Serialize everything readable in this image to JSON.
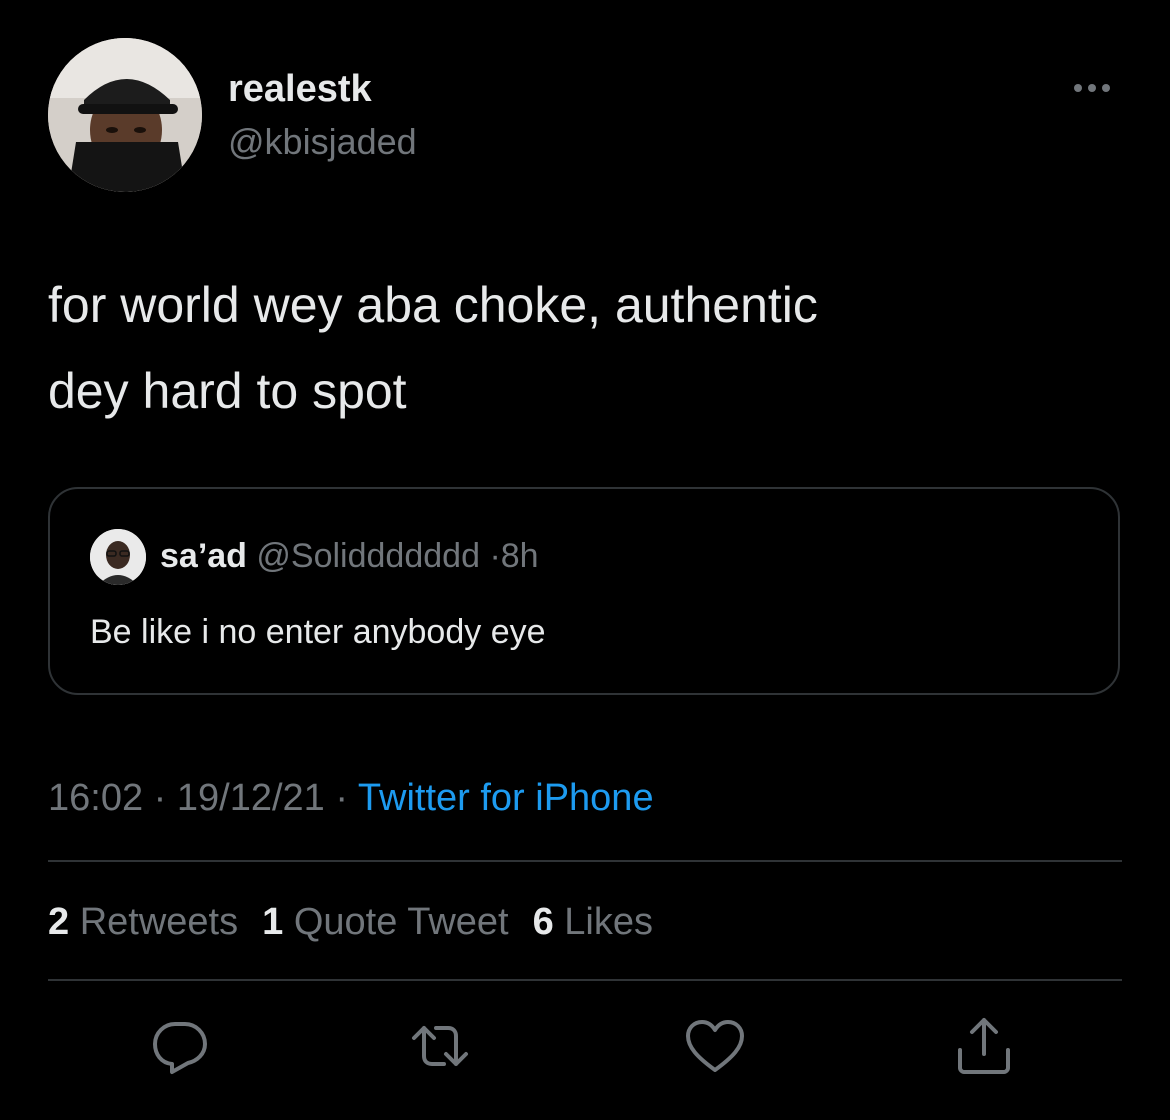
{
  "author": {
    "name": "realestk",
    "handle": "@kbisjaded"
  },
  "tweet": {
    "text_lines": [
      "for world wey aba choke, authentic",
      "dey hard to spot"
    ]
  },
  "quoted_tweet": {
    "name": "sa’ad",
    "handle": "@Soliddddddd",
    "separator": "·",
    "time": "8h",
    "text": "Be like i no enter anybody eye"
  },
  "meta": {
    "time": "16:02",
    "sep1": "·",
    "date": "19/12/21",
    "sep2": "·",
    "source": "Twitter for iPhone"
  },
  "stats": {
    "retweets": {
      "count": "2",
      "label": "Retweets"
    },
    "quote_tweets": {
      "count": "1",
      "label": "Quote Tweet"
    },
    "likes": {
      "count": "6",
      "label": "Likes"
    }
  },
  "icons": {
    "more": "more-icon",
    "reply": "reply-icon",
    "retweet": "retweet-icon",
    "like": "like-icon",
    "share": "share-icon"
  },
  "colors": {
    "background": "#000000",
    "text_primary": "#e7e9ea",
    "text_secondary": "#71767b",
    "accent": "#1d9bf0",
    "border": "#2f3336"
  }
}
